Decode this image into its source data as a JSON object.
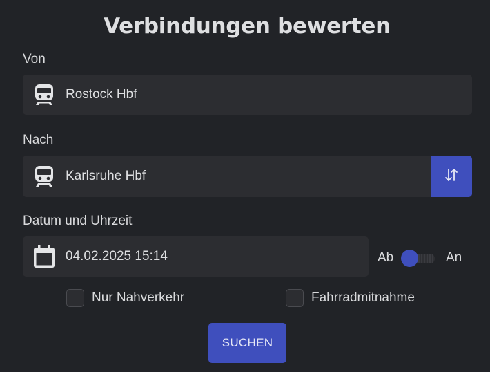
{
  "title": "Verbindungen bewerten",
  "from": {
    "label": "Von",
    "value": "Rostock Hbf",
    "icon": "train-icon"
  },
  "to": {
    "label": "Nach",
    "value": "Karlsruhe Hbf",
    "icon": "train-icon",
    "swap_icon": "swap-vertical-icon"
  },
  "datetime": {
    "label": "Datum und Uhrzeit",
    "value": "04.02.2025 15:14",
    "icon": "calendar-icon",
    "toggle_left_label": "Ab",
    "toggle_right_label": "An",
    "toggle_state": "Ab"
  },
  "options": [
    {
      "label": "Nur Nahverkehr",
      "checked": false
    },
    {
      "label": "Fahrradmitnahme",
      "checked": false
    }
  ],
  "search_button": "SUCHEN",
  "colors": {
    "background": "#212327",
    "field": "#2c2d31",
    "accent": "#3f4fbd",
    "text": "#dfe0e2"
  }
}
